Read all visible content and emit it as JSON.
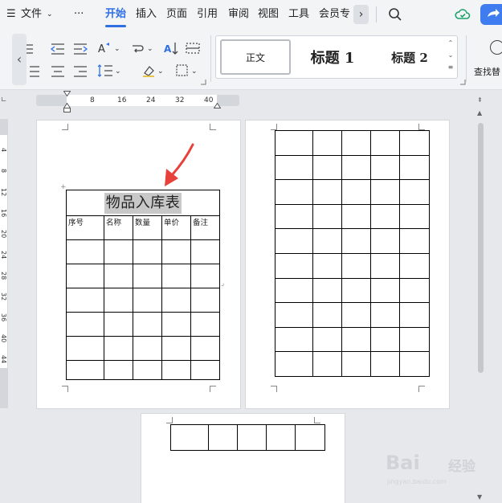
{
  "menubar": {
    "file_label": "文件",
    "more_label": "···",
    "tabs": [
      "开始",
      "插入",
      "页面",
      "引用",
      "审阅",
      "视图",
      "工具",
      "会员专"
    ],
    "active_tab": "开始"
  },
  "ribbon": {
    "styles": {
      "normal": "正文",
      "heading1": "标题  1",
      "heading2": "标题  2"
    },
    "find_label": "查找替"
  },
  "ruler": {
    "h_marks": [
      "8",
      "16",
      "24",
      "32",
      "40"
    ],
    "v_marks": [
      "4",
      "8",
      "12",
      "16",
      "20",
      "24",
      "28",
      "32",
      "36",
      "40",
      "44"
    ]
  },
  "document": {
    "table_title": "物品入库表",
    "columns": [
      "序号",
      "名称",
      "数量",
      "单价",
      "备注"
    ]
  },
  "watermark": {
    "brand": "Bai",
    "brand_cn": "经验",
    "sub": "jingyan.baidu.com"
  },
  "colors": {
    "accent": "#2f6fe4",
    "arrow": "#e8403a",
    "highlight": "#c8c8c8"
  }
}
